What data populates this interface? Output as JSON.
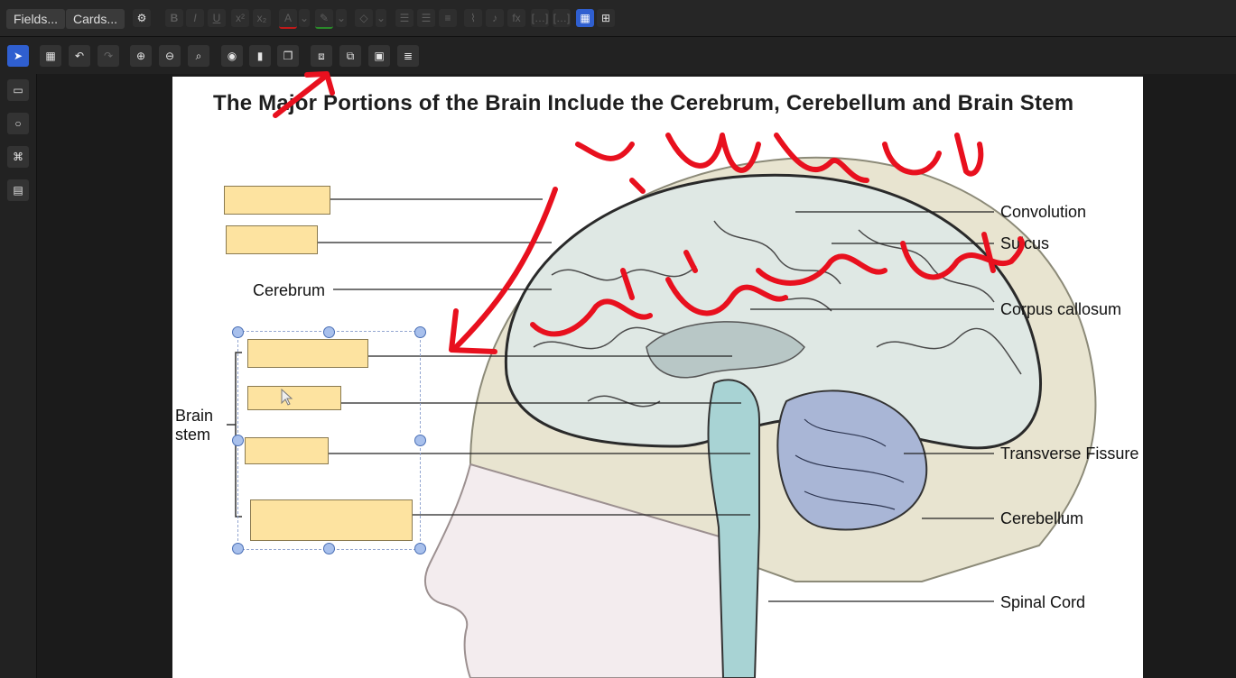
{
  "toolbar": {
    "fields_label": "Fields...",
    "cards_label": "Cards..."
  },
  "diagram": {
    "title": "The Major Portions of the Brain Include the Cerebrum, Cerebellum and Brain Stem",
    "labels": {
      "cerebrum": "Cerebrum",
      "brain_stem": "Brain\nstem",
      "convolution": "Convolution",
      "sulcus": "Sulcus",
      "corpus_callosum": "Corpus callosum",
      "transverse_fissure": "Transverse Fissure",
      "cerebellum": "Cerebellum",
      "spinal_cord": "Spinal Cord"
    }
  },
  "annotation": {
    "handwritten_text": "به جای ۴ کارت ۱ کارت ایجاد میکند",
    "color": "#e8101e"
  },
  "colors": {
    "occlusion_fill": "#fde3a0",
    "accent": "#2f5fd0",
    "brain_fill": "#dfe8e4",
    "cerebellum_fill": "#a9b6d6",
    "stem_fill": "#a8d3d4"
  }
}
